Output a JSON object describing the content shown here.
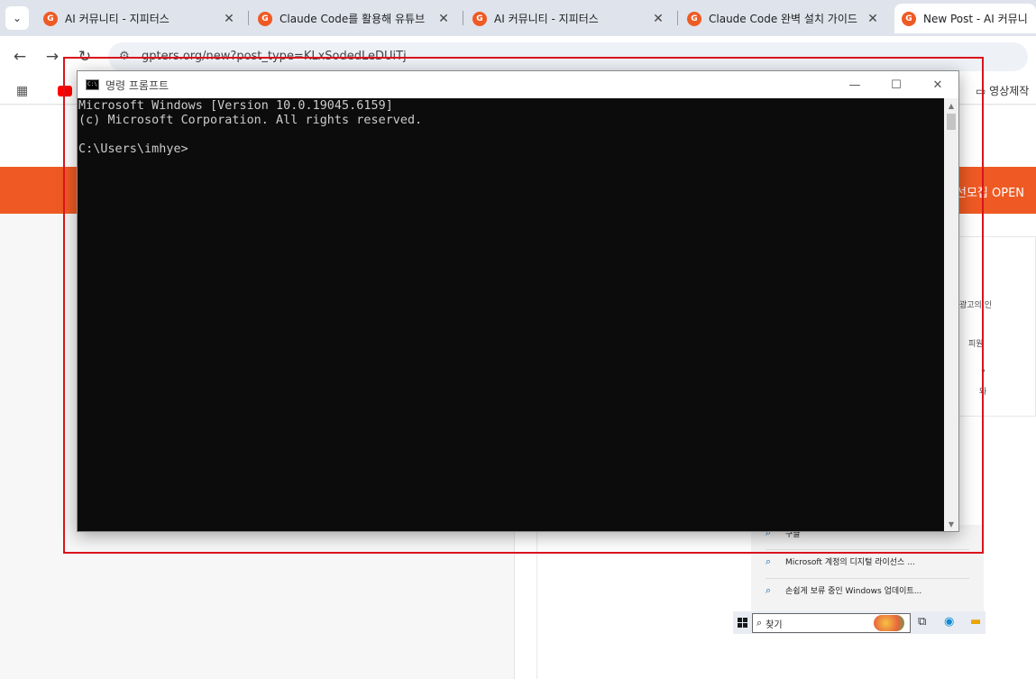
{
  "browser": {
    "tabs": [
      {
        "title": "AI 커뮤니티 - 지피터스",
        "favicon": "gpters-icon"
      },
      {
        "title": "Claude Code를 활용해 유튜브",
        "favicon": "gpters-icon"
      },
      {
        "title": "AI 커뮤니티 - 지피터스",
        "favicon": "gpters-icon"
      },
      {
        "title": "Claude Code 완벽 설치 가이드",
        "favicon": "gpters-icon"
      },
      {
        "title": "New Post - AI 커뮤니티",
        "favicon": "gpters-icon",
        "active": true
      }
    ],
    "url": "gpters.org/new?post_type=KLxSodedLeDUiTj",
    "bookmark_folder": "영상제작"
  },
  "page": {
    "banner_text": "선모집 OPEN",
    "side_panel": [
      "광고의 인",
      "피원",
      "?",
      "와"
    ]
  },
  "search_popup": {
    "results": [
      "구글",
      "Microsoft 계정의 디지털 라이선스 ...",
      "손쉽게 보류 중인 Windows 업데이트..."
    ]
  },
  "taskbar": {
    "search_placeholder": "찾기"
  },
  "cmd": {
    "title": "명령 프롬프트",
    "lines": [
      "Microsoft Windows [Version 10.0.19045.6159]",
      "(c) Microsoft Corporation. All rights reserved.",
      "",
      "C:\\Users\\imhye>"
    ],
    "colors": {
      "background": "#0c0c0c",
      "text": "#cccccc"
    }
  },
  "annotation": {
    "color": "#d9141c"
  }
}
